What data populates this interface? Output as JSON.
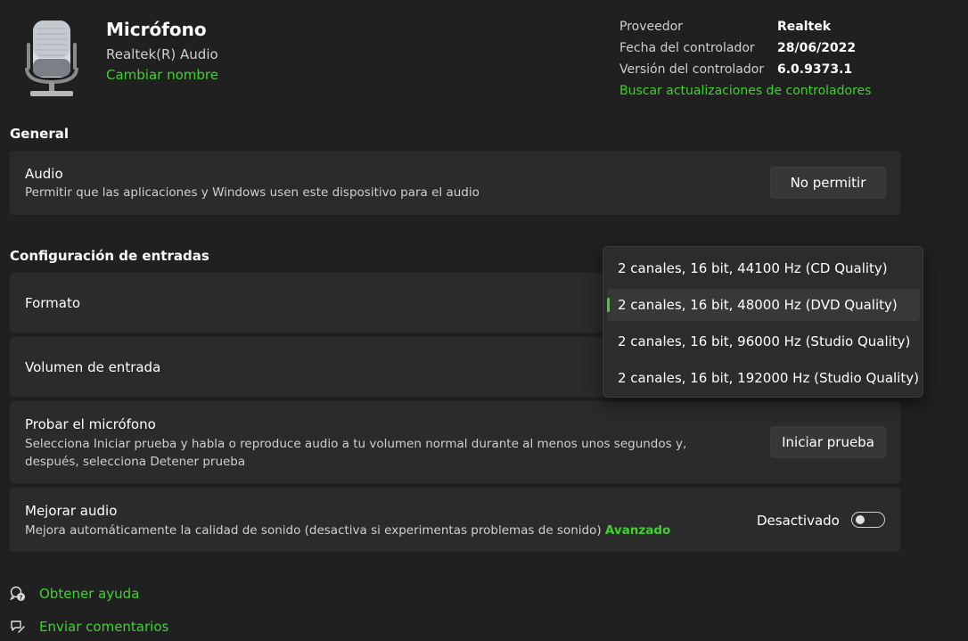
{
  "header": {
    "title": "Micrófono",
    "subtitle": "Realtek(R) Audio",
    "rename_link": "Cambiar nombre",
    "icon": "microphone-icon"
  },
  "driver": {
    "provider_label": "Proveedor",
    "provider_value": "Realtek",
    "date_label": "Fecha del controlador",
    "date_value": "28/06/2022",
    "version_label": "Versión del controlador",
    "version_value": "6.0.9373.1",
    "update_link": "Buscar actualizaciones de controladores"
  },
  "general": {
    "title": "General",
    "audio": {
      "title": "Audio",
      "description": "Permitir que las aplicaciones y Windows usen este dispositivo para el audio",
      "button": "No permitir"
    }
  },
  "inputs": {
    "title": "Configuración de entradas",
    "format_label": "Formato",
    "volume_label": "Volumen de entrada",
    "format_options": [
      "2 canales, 16 bit, 44100 Hz (CD Quality)",
      "2 canales, 16 bit, 48000 Hz (DVD Quality)",
      "2 canales, 16 bit, 96000 Hz (Studio Quality)",
      "2 canales, 16 bit, 192000 Hz (Studio Quality)"
    ],
    "selected_index": 1
  },
  "test": {
    "title": "Probar el micrófono",
    "description_line1": "Selecciona Iniciar prueba y habla o reproduce audio a tu volumen normal durante al menos unos segundos y,",
    "description_line2": "después, selecciona Detener prueba",
    "button": "Iniciar prueba"
  },
  "enhance": {
    "title": "Mejorar audio",
    "description": "Mejora automáticamente la calidad de sonido (desactiva si experimentas problemas de sonido)",
    "advanced_link": "Avanzado",
    "toggle_label": "Desactivado",
    "toggle_on": false
  },
  "footer": {
    "help": "Obtener ayuda",
    "feedback": "Enviar comentarios"
  },
  "colors": {
    "accent": "#3fd12f",
    "background": "#202020",
    "card": "#2b2b2b"
  }
}
